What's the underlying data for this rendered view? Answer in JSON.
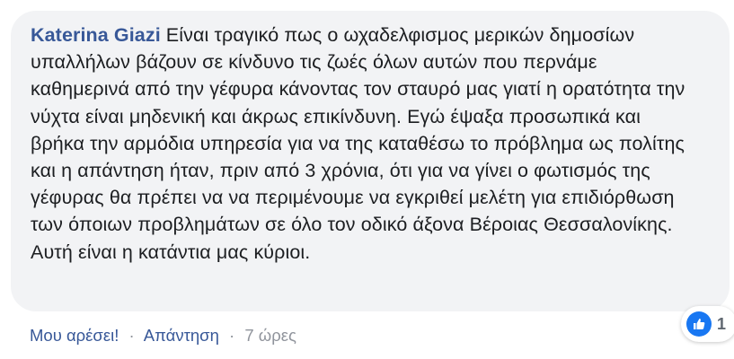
{
  "comment": {
    "author": "Katerina Giazi",
    "text": "Είναι τραγικό πως ο ωχαδελφισμος μερικών δημοσίων υπαλλήλων βάζουν σε κίνδυνο τις ζωές όλων αυτών που περνάμε καθημερινά από την γέφυρα κάνοντας τον σταυρό μας γιατί η ορατότητα την νύχτα είναι μηδενική και άκρως επικίνδυνη. Εγώ έψαξα προσωπικά και βρήκα την αρμόδια υπηρεσία για να της καταθέσω το πρόβλημα ως πολίτης και η απάντηση ήταν, πριν από 3 χρόνια, ότι για να γίνει ο φωτισμός της γέφυρας θα πρέπει να να περιμένουμε να εγκριθεί μελέτη για επιδιόρθωση των όποιων προβλημάτων σε όλο τον οδικό άξονα Βέροιας Θεσσαλονίκης. Αυτή είναι η κατάντια μας κύριοι."
  },
  "actions": {
    "like_label": "Μου αρέσει!",
    "reply_label": "Απάντηση",
    "separator": "·",
    "time": "7 ώρες"
  },
  "reactions": {
    "icon": "thumbs-up-icon",
    "count": "1",
    "color": "#1877f2"
  },
  "colors": {
    "link": "#385898",
    "text": "#1c1e21",
    "bubble": "#f2f3f5",
    "meta": "#90949c"
  }
}
